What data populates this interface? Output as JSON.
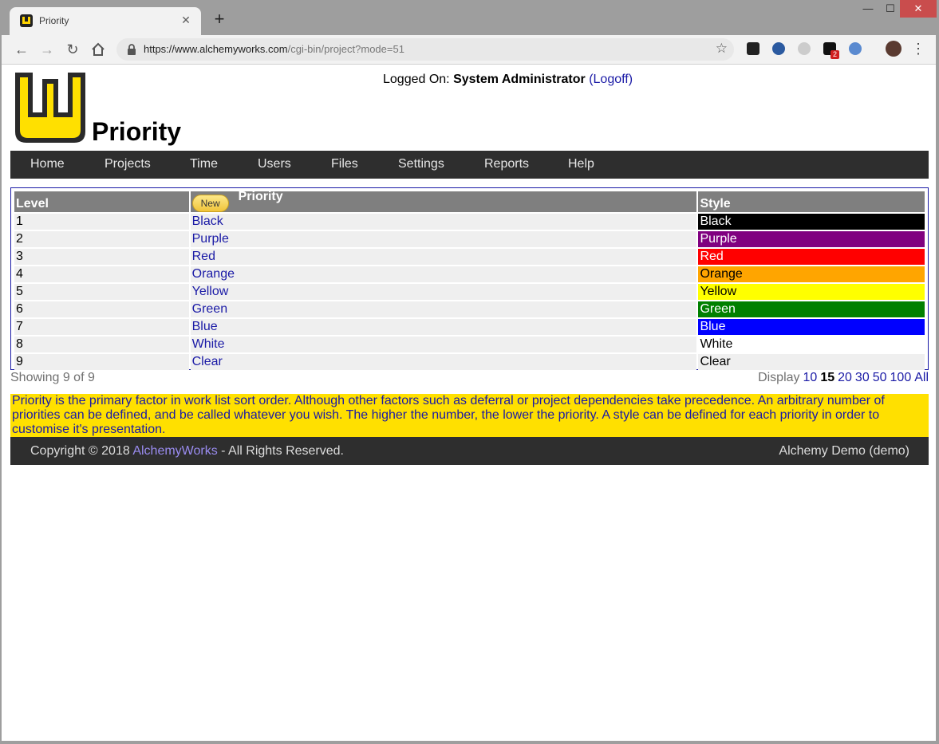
{
  "browser": {
    "tab_title": "Priority",
    "tab_close": "✕",
    "new_tab": "+",
    "url_host": "https://www.alchemyworks.com",
    "url_path": "/cgi-bin/project?mode=51",
    "ext_badge": "2",
    "win_min": "—",
    "win_max": "☐",
    "win_close": "✕"
  },
  "header": {
    "title": "Priority",
    "login_prefix": "Logged On:",
    "user": "System Administrator",
    "logoff": "Logoff"
  },
  "nav": [
    "Home",
    "Projects",
    "Time",
    "Users",
    "Files",
    "Settings",
    "Reports",
    "Help"
  ],
  "table": {
    "col_level": "Level",
    "new_button": "New",
    "col_priority": "Priority",
    "col_style": "Style",
    "rows": [
      {
        "level": "1",
        "name": "Black",
        "style": "Black",
        "bg": "#000000",
        "fg": "#ffffff"
      },
      {
        "level": "2",
        "name": "Purple",
        "style": "Purple",
        "bg": "#800080",
        "fg": "#ffffff"
      },
      {
        "level": "3",
        "name": "Red",
        "style": "Red",
        "bg": "#ff0000",
        "fg": "#ffffff"
      },
      {
        "level": "4",
        "name": "Orange",
        "style": "Orange",
        "bg": "#ffa500",
        "fg": "#000000"
      },
      {
        "level": "5",
        "name": "Yellow",
        "style": "Yellow",
        "bg": "#ffff00",
        "fg": "#000000"
      },
      {
        "level": "6",
        "name": "Green",
        "style": "Green",
        "bg": "#008000",
        "fg": "#ffffff"
      },
      {
        "level": "7",
        "name": "Blue",
        "style": "Blue",
        "bg": "#0000ff",
        "fg": "#ffffff"
      },
      {
        "level": "8",
        "name": "White",
        "style": "White",
        "bg": "#ffffff",
        "fg": "#000000"
      },
      {
        "level": "9",
        "name": "Clear",
        "style": "Clear",
        "bg": "#efefef",
        "fg": "#000000"
      }
    ]
  },
  "pager": {
    "showing": "Showing 9 of 9",
    "display_label": "Display",
    "options": [
      "10",
      "15",
      "20",
      "30",
      "50",
      "100",
      "All"
    ],
    "current": "15"
  },
  "info_text": "Priority is the primary factor in work list sort order. Although other factors such as deferral or project dependencies take precedence. An arbitrary number of priorities can be defined, and be called whatever you wish. The higher the number, the lower the priority. A style can be defined for each priority in order to customise it's presentation.",
  "footer": {
    "copyright_prefix": "Copyright © 2018",
    "brand": "AlchemyWorks",
    "copyright_suffix": "- All Rights Reserved.",
    "instance": "Alchemy Demo (demo)"
  },
  "colors": {
    "nav_bg": "#2e2e2e",
    "info_bg": "#ffe000",
    "link": "#1a1aa6",
    "brand_link": "#9a8cf0"
  }
}
